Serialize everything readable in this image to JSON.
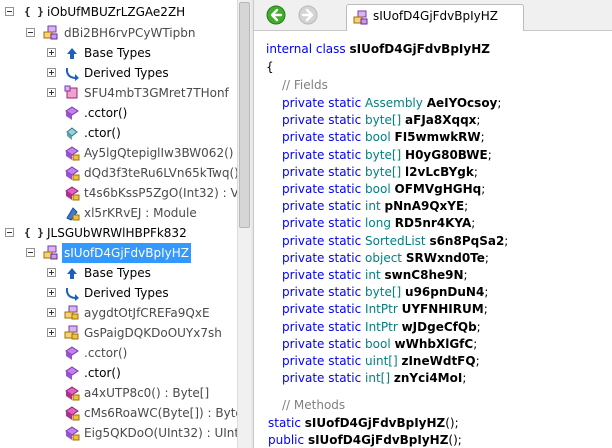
{
  "tree": {
    "ns1": {
      "label": "iObUfMBUZrLZGAe2ZH"
    },
    "class1": {
      "label": "dBi2BH6rvPCyWTipbn",
      "base_types": "Base Types",
      "derived_types": "Derived Types",
      "nested": "SFU4mbT3GMret7THonf",
      "cctor": ".cctor()",
      "ctor": ".ctor()",
      "m1": "Ay5lgQtepiglIw3BW062() :",
      "m2": "dQd3f3teRu6LVn65kTwq()",
      "m3": "t4s6bKssP5ZgO(Int32) : Vc",
      "m4": "xl5rKRvEJ : Module"
    },
    "ns2": {
      "label": "JLSGUbWRWlHBPFk832"
    },
    "class2": {
      "label": "sIUofD4GjFdvBpIyHZ",
      "base_types": "Base Types",
      "derived_types": "Derived Types",
      "nested1": "aygdtOtJfCREFa9QxE",
      "nested2": "GsPaigDQKDoOUYx7sh",
      "cctor": ".cctor()",
      "ctor": ".ctor()",
      "m1": "a4xUTP8c0() : Byte[]",
      "m2": "cMs6RoaWC(Byte[]) : Byte",
      "m3": "Eig5QKDoO(UInt32) : UInt"
    }
  },
  "tab": {
    "label": "sIUofD4GjFdvBpIyHZ"
  },
  "code": {
    "decl_kw": "internal class",
    "decl_name": "sIUofD4GjFdvBpIyHZ",
    "open_brace": "{",
    "fields_comment": "// Fields",
    "methods_comment": "// Methods",
    "fields": [
      {
        "mods": "private static",
        "type": "Assembly",
        "name": "AeIYOcsoy"
      },
      {
        "mods": "private static",
        "type": "byte[]",
        "name": "aFJa8Xqqx"
      },
      {
        "mods": "private static",
        "type": "bool",
        "name": "FI5wmwkRW"
      },
      {
        "mods": "private static",
        "type": "byte[]",
        "name": "H0yG80BWE"
      },
      {
        "mods": "private static",
        "type": "byte[]",
        "name": "l2vLcBYgk"
      },
      {
        "mods": "private static",
        "type": "bool",
        "name": "OFMVgHGHq"
      },
      {
        "mods": "private static",
        "type": "int",
        "name": "pNnA9QxYE"
      },
      {
        "mods": "private static",
        "type": "long",
        "name": "RD5nr4KYA"
      },
      {
        "mods": "private static",
        "type": "SortedList",
        "name": "s6n8PqSa2"
      },
      {
        "mods": "private static",
        "type": "object",
        "name": "SRWxnd0Te"
      },
      {
        "mods": "private static",
        "type": "int",
        "name": "swnC8he9N"
      },
      {
        "mods": "private static",
        "type": "byte[]",
        "name": "u96pnDuN4"
      },
      {
        "mods": "private static",
        "type": "IntPtr",
        "name": "UYFNHIRUM"
      },
      {
        "mods": "private static",
        "type": "IntPtr",
        "name": "wJDgeCfQb"
      },
      {
        "mods": "private static",
        "type": "bool",
        "name": "wWhbXlGfC"
      },
      {
        "mods": "private static",
        "type": "uint[]",
        "name": "zIneWdtFQ"
      },
      {
        "mods": "private static",
        "type": "int[]",
        "name": "znYci4MoI"
      }
    ],
    "methods": [
      {
        "mods": "static",
        "name": "sIUofD4GjFdvBpIyHZ",
        "sig": "();"
      },
      {
        "mods": "public",
        "name": "sIUofD4GjFdvBpIyHZ",
        "sig": "();"
      }
    ]
  },
  "colors": {
    "keyword": "#0000ff",
    "type": "#008080",
    "comment": "#808080",
    "selection": "#3399ff"
  }
}
